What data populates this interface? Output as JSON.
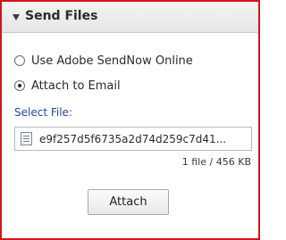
{
  "panel": {
    "title": "Send Files",
    "accent_border_color": "#d0161b"
  },
  "options": [
    {
      "label": "Use Adobe SendNow Online",
      "selected": false
    },
    {
      "label": "Attach to Email",
      "selected": true
    }
  ],
  "select_file": {
    "label": "Select File:",
    "file_name": "e9f257d5f6735a2d74d259c7d41...",
    "icon": "document-icon",
    "summary": "1 file / 456 KB"
  },
  "actions": {
    "attach_label": "Attach"
  }
}
